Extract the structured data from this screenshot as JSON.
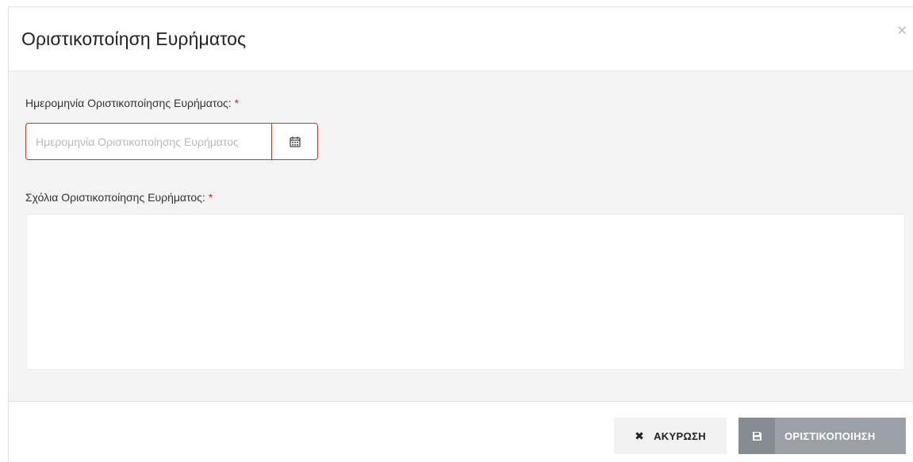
{
  "modal": {
    "title": "Οριστικοποίηση Ευρήματος",
    "close_symbol": "×"
  },
  "form": {
    "date_label": "Ημερομηνία Οριστικοποίησης Ευρήματος:",
    "date_placeholder": "Ημερομηνία Οριστικοποίησης Ευρήματος",
    "date_value": "",
    "comments_label": "Σχόλια Οριστικοποίησης Ευρήματος:",
    "comments_value": "",
    "required_mark": "*"
  },
  "footer": {
    "cancel_icon": "✖",
    "cancel_label": "ΑΚΥΡΩΣΗ",
    "finalize_label": "ΟΡΙΣΤΙΚΟΠΟΙΗΣΗ"
  },
  "icons": {
    "calendar": "calendar-icon",
    "close": "close-icon",
    "cancel": "times-icon",
    "save": "floppy-disk-icon"
  },
  "colors": {
    "required": "#cc2222",
    "invalid_border": "#c0392b",
    "finalize_button": "#9aa0a6",
    "finalize_icon_bg": "#868c92",
    "body_bg": "#f4f4f4"
  }
}
